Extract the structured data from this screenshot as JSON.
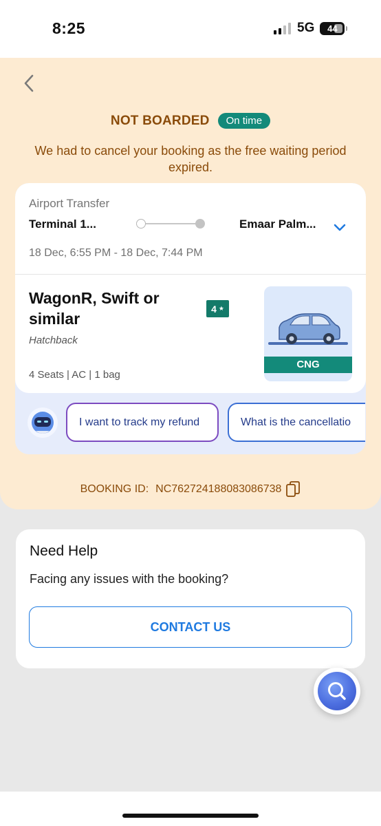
{
  "status_bar": {
    "time": "8:25",
    "network": "5G",
    "battery": "44"
  },
  "header": {
    "status_title": "NOT BOARDED",
    "status_badge": "On time",
    "message": "We had to cancel your booking as the free waiting period expired."
  },
  "trip": {
    "type": "Airport Transfer",
    "from": "Terminal 1...",
    "to": "Emaar Palm...",
    "time_range": "18 Dec, 6:55 PM - 18 Dec, 7:44 PM"
  },
  "vehicle": {
    "name": "WagonR, Swift or similar",
    "rating": "4",
    "category": "Hatchback",
    "features": "4 Seats | AC | 1 bag",
    "fuel": "CNG"
  },
  "suggestions": [
    "I want to track my refund",
    "What is the cancellatio"
  ],
  "booking": {
    "id_label": "BOOKING ID:",
    "id_value": "NC762724188083086738"
  },
  "help": {
    "title": "Need Help",
    "subtitle": "Facing any issues with the booking?",
    "contact_label": "CONTACT US"
  },
  "colors": {
    "accent": "#1f7ae0",
    "status_brown": "#8a4b0a",
    "teal": "#138a7a",
    "cream": "#fdebd2"
  }
}
